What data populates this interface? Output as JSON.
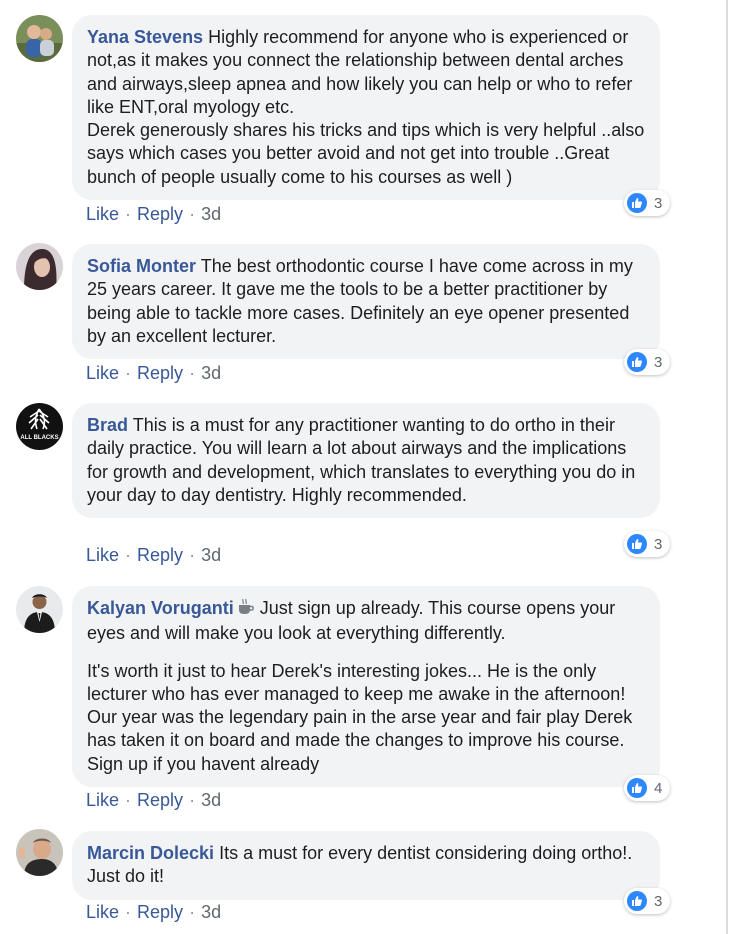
{
  "actions": {
    "like_label": "Like",
    "reply_label": "Reply",
    "separator": "·"
  },
  "colors": {
    "name": "#385898",
    "bubble": "#f2f3f5",
    "like_badge": "#2d88ff"
  },
  "comments": [
    {
      "author": "Yana Stevens",
      "text": "Highly recommend for anyone who is experienced or not,as it makes you connect the relationship between dental arches and airways,sleep apnea and how likely you can help or who to refer like ENT,oral myology etc.",
      "text2": "Derek generously shares his tricks and tips which is very helpful ..also says which cases you better avoid and not get into trouble ..Great bunch of people usually come to his courses as well )",
      "time": "3d",
      "like_count": "3"
    },
    {
      "author": "Sofia Monter",
      "text": "The best orthodontic course I have come across in my 25 years career. It gave me the tools to be a better practitioner by being able to tackle more cases. Definitely an eye opener presented by an excellent lecturer.",
      "time": "3d",
      "like_count": "3"
    },
    {
      "author": "Brad",
      "text": "This is a must for any practitioner wanting to do ortho in their daily practice. You will learn a lot about airways and the implications for growth and development, which translates to everything you do in your day to day dentistry. Highly recommended.",
      "avatar_text": "ALL BLACKS",
      "time": "3d",
      "like_count": "3"
    },
    {
      "author": "Kalyan Voruganti",
      "text": "Just sign up already. This course opens your eyes and will make you look at everything differently.",
      "text2": "It's worth it just to hear Derek's interesting jokes... He is the only lecturer who has ever managed to keep me awake in the afternoon! Our year was the legendary pain in the arse year and fair play Derek has taken it on board and made the changes to improve his course. Sign up if you havent already",
      "badge_icon": "coffee-cup-icon",
      "time": "3d",
      "like_count": "4"
    },
    {
      "author": "Marcin Dolecki",
      "text": "Its a must for every dentist considering doing ortho!. Just do it!",
      "time": "3d",
      "like_count": "3"
    }
  ]
}
